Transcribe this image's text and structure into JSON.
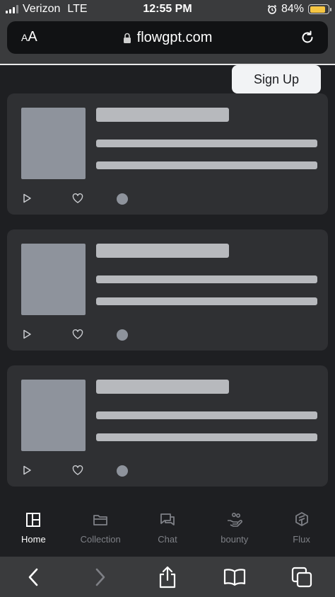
{
  "status_bar": {
    "carrier": "Verizon",
    "network": "LTE",
    "time": "12:55 PM",
    "battery": "84%",
    "battery_level": 0.84
  },
  "browser": {
    "text_size_label": "AA",
    "url": "flowgpt.com"
  },
  "header": {
    "signup_label": "Sign Up"
  },
  "cards_count": 3,
  "bottom_nav": {
    "items": [
      {
        "label": "Home",
        "icon": "layout-icon",
        "active": true
      },
      {
        "label": "Collection",
        "icon": "folder-icon",
        "active": false
      },
      {
        "label": "Chat",
        "icon": "chat-icon",
        "active": false
      },
      {
        "label": "bounty",
        "icon": "hand-coins-icon",
        "active": false
      },
      {
        "label": "Flux",
        "icon": "flux-logo-icon",
        "active": false
      }
    ]
  },
  "colors": {
    "background": "#1e1f22",
    "card": "#2f3033",
    "skeleton": "#b7b9bd",
    "chrome": "#3a3b3d",
    "battery": "#f5c542"
  }
}
